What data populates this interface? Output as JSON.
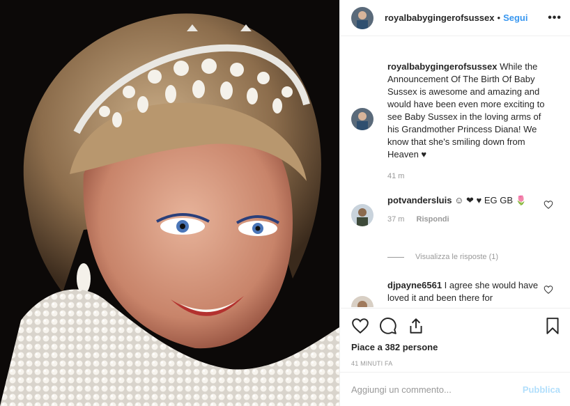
{
  "post": {
    "image_alt": "Portrait photo of Princess Diana wearing a pearl tiara",
    "username": "royalbabygingerofsussex",
    "separator": "•",
    "follow_label": "Segui",
    "more_label": "•••"
  },
  "caption": {
    "username": "royalbabygingerofsussex",
    "text": "While the Announcement Of The Birth Of Baby Sussex is awesome and amazing and would have been even more exciting to see Baby Sussex in the loving arms of his Grandmother Princess Diana! We know that she's smiling down from Heaven ♥",
    "time": "41 m"
  },
  "comments": [
    {
      "username": "potvandersluis",
      "text": "☺ ❤ ♥ EG GB 🌷",
      "time": "37 m",
      "reply_label": "Rispondi"
    },
    {
      "username": "djpayne6561",
      "text": "I agree she would have loved it and been there for"
    }
  ],
  "view_replies_label": "Visualizza le risposte (1)",
  "likes_text": "Piace a 382 persone",
  "time_ago": "41 MINUTI FA",
  "add_comment": {
    "placeholder": "Aggiungi un commento...",
    "publish_label": "Pubblica"
  },
  "colors": {
    "accent": "#3897f0",
    "publish_disabled": "#b2dffc",
    "muted": "#999999"
  }
}
